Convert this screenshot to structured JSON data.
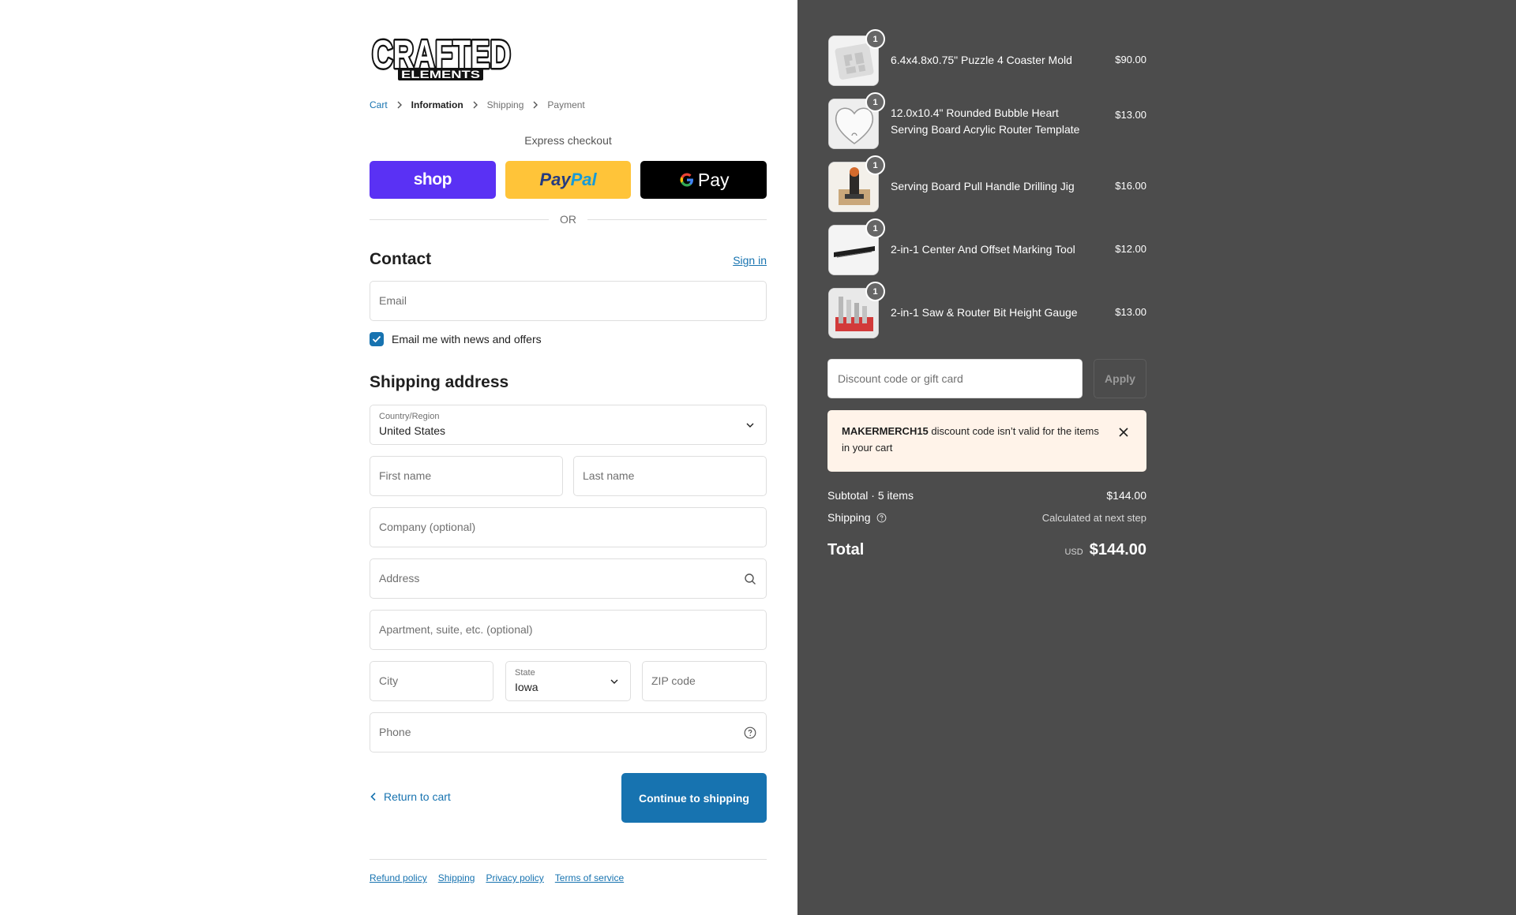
{
  "brand": {
    "logo_line1": "CRAFTED",
    "logo_line2": "ELEMENTS"
  },
  "breadcrumb": {
    "cart": "Cart",
    "information": "Information",
    "shipping": "Shipping",
    "payment": "Payment"
  },
  "express": {
    "title": "Express checkout",
    "shop_label": "shop",
    "paypal_part1": "Pay",
    "paypal_part2": "Pal",
    "gpay_label": "Pay",
    "or_text": "OR"
  },
  "contact": {
    "heading": "Contact",
    "signin_label": "Sign in",
    "email_placeholder": "Email",
    "newsletter_label": "Email me with news and offers",
    "newsletter_checked": true
  },
  "shipping_address": {
    "heading": "Shipping address",
    "country_label": "Country/Region",
    "country_value": "United States",
    "first_name_placeholder": "First name",
    "last_name_placeholder": "Last name",
    "company_placeholder": "Company (optional)",
    "address_placeholder": "Address",
    "apartment_placeholder": "Apartment, suite, etc. (optional)",
    "city_placeholder": "City",
    "state_label": "State",
    "state_value": "Iowa",
    "zip_placeholder": "ZIP code",
    "phone_placeholder": "Phone"
  },
  "actions": {
    "return_label": "Return to cart",
    "continue_label": "Continue to shipping"
  },
  "footer": {
    "links": [
      "Refund policy",
      "Shipping",
      "Privacy policy",
      "Terms of service"
    ]
  },
  "cart": {
    "items": [
      {
        "quantity": "1",
        "name": "6.4x4.8x0.75\" Puzzle 4 Coaster Mold",
        "price": "$90.00"
      },
      {
        "quantity": "1",
        "name": "12.0x10.4\" Rounded Bubble Heart Serving Board Acrylic Router Template",
        "price": "$13.00"
      },
      {
        "quantity": "1",
        "name": "Serving Board Pull Handle Drilling Jig",
        "price": "$16.00"
      },
      {
        "quantity": "1",
        "name": "2-in-1 Center And Offset Marking Tool",
        "price": "$12.00"
      },
      {
        "quantity": "1",
        "name": "2-in-1 Saw & Router Bit Height Gauge",
        "price": "$13.00"
      }
    ],
    "discount_placeholder": "Discount code or gift card",
    "apply_label": "Apply",
    "notice_code": "MAKERMERCH15",
    "notice_message": " discount code isn’t valid for the items in your cart",
    "subtotal_label": "Subtotal · 5 items",
    "subtotal_value": "$144.00",
    "shipping_label": "Shipping",
    "shipping_value": "Calculated at next step",
    "total_label": "Total",
    "total_currency": "USD",
    "total_value": "$144.00"
  },
  "colors": {
    "accent": "#1773b0",
    "shop_pay": "#5a31f4",
    "paypal": "#ffc439",
    "summary_bg": "#4c4c4c",
    "notice_bg": "#fff3e9"
  }
}
